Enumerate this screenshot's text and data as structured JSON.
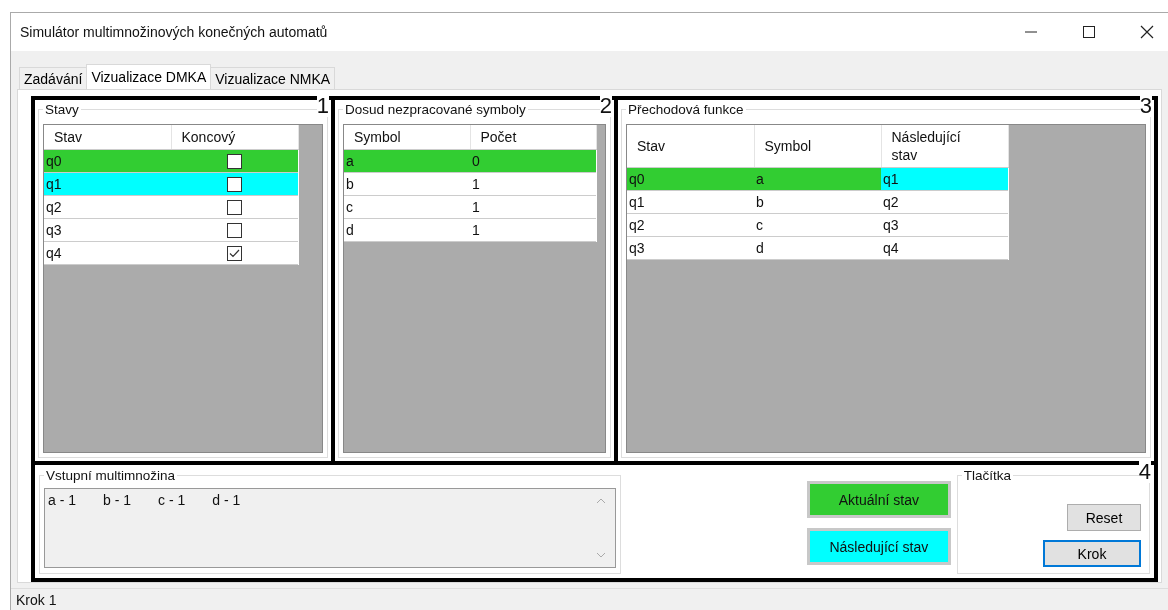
{
  "window": {
    "title": "Simulátor multimnožinových konečných automatů"
  },
  "tabs": [
    {
      "label": "Zadávání",
      "selected": false
    },
    {
      "label": "Vizualizace DMKA",
      "selected": true
    },
    {
      "label": "Vizualizace NMKA",
      "selected": false
    }
  ],
  "states_panel": {
    "title": "Stavy",
    "number": "1",
    "columns": [
      "Stav",
      "Koncový"
    ],
    "rows": [
      {
        "state": "q0",
        "final": false,
        "color": "#32cd32"
      },
      {
        "state": "q1",
        "final": false,
        "color": "#00ffff"
      },
      {
        "state": "q2",
        "final": false
      },
      {
        "state": "q3",
        "final": false
      },
      {
        "state": "q4",
        "final": true
      }
    ]
  },
  "symbols_panel": {
    "title": "Dosud nezpracované symboly",
    "number": "2",
    "columns": [
      "Symbol",
      "Počet"
    ],
    "rows": [
      {
        "symbol": "a",
        "count": "0",
        "color": "#32cd32"
      },
      {
        "symbol": "b",
        "count": "1"
      },
      {
        "symbol": "c",
        "count": "1"
      },
      {
        "symbol": "d",
        "count": "1"
      }
    ]
  },
  "transitions_panel": {
    "title": "Přechodová funkce",
    "number": "3",
    "columns": [
      "Stav",
      "Symbol",
      "Následující stav"
    ],
    "rows": [
      {
        "cells": [
          {
            "text": "q0",
            "color": "#32cd32"
          },
          {
            "text": "a",
            "color": "#32cd32"
          },
          {
            "text": "q1",
            "color": "#00ffff"
          }
        ]
      },
      {
        "cells": [
          {
            "text": "q1"
          },
          {
            "text": "b"
          },
          {
            "text": "q2"
          }
        ]
      },
      {
        "cells": [
          {
            "text": "q2"
          },
          {
            "text": "c"
          },
          {
            "text": "q3"
          }
        ]
      },
      {
        "cells": [
          {
            "text": "q3"
          },
          {
            "text": "d"
          },
          {
            "text": "q4"
          }
        ]
      }
    ]
  },
  "input_panel": {
    "title": "Vstupní multimnožina",
    "items": [
      "a - 1",
      "b - 1",
      "c - 1",
      "d - 1"
    ]
  },
  "legend": [
    {
      "label": "Aktuální stav",
      "color": "#32cd32"
    },
    {
      "label": "Následující stav",
      "color": "#00ffff"
    }
  ],
  "buttons_panel": {
    "title": "Tlačítka",
    "number": "4",
    "buttons": [
      {
        "label": "Reset",
        "focused": false
      },
      {
        "label": "Krok",
        "focused": true
      }
    ]
  },
  "status_bar": {
    "text": "Krok 1"
  }
}
